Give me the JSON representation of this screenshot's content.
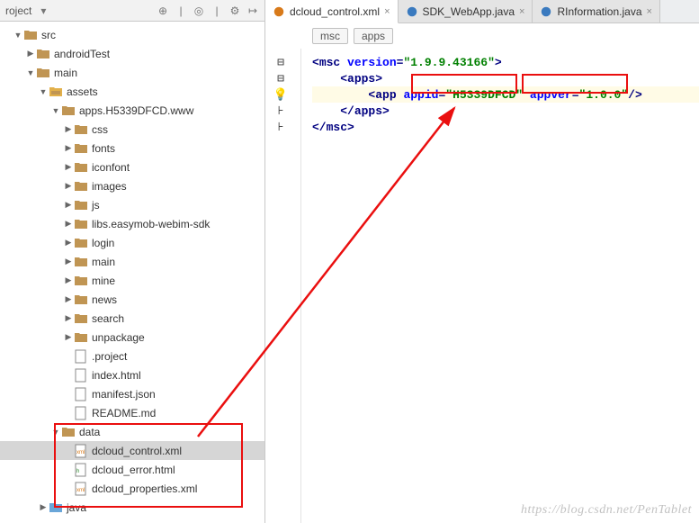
{
  "project_panel_title": "roject",
  "tree": {
    "src": "src",
    "androidTest": "androidTest",
    "main": "main",
    "assets": "assets",
    "apps_folder": "apps.H5339DFCD.www",
    "sub": {
      "css": "css",
      "fonts": "fonts",
      "iconfont": "iconfont",
      "images": "images",
      "js": "js",
      "libs": "libs.easymob-webim-sdk",
      "login": "login",
      "main": "main",
      "mine": "mine",
      "news": "news",
      "search": "search",
      "unpackage": "unpackage",
      "project_file": ".project",
      "index_html": "index.html",
      "manifest": "manifest.json",
      "readme": "README.md"
    },
    "data": "data",
    "data_children": {
      "control": "dcloud_control.xml",
      "error": "dcloud_error.html",
      "properties": "dcloud_properties.xml"
    },
    "java_folder": "java"
  },
  "tabs": [
    {
      "label": "dcloud_control.xml",
      "icon": "xml-file-icon",
      "active": true
    },
    {
      "label": "SDK_WebApp.java",
      "icon": "class-file-icon",
      "active": false
    },
    {
      "label": "RInformation.java",
      "icon": "class-file-icon",
      "active": false
    }
  ],
  "breadcrumbs": [
    "msc",
    "apps"
  ],
  "xml": {
    "root_tag": "msc",
    "version_attr": "version",
    "version_val": "\"1.9.9.43166\"",
    "apps_tag": "apps",
    "app_tag": "app",
    "appid_attr": "appid",
    "appid_val": "\"H5339DFCD\"",
    "appver_attr": "appver",
    "appver_val": "\"1.0.0\""
  },
  "watermark": "https://blog.csdn.net/PenTablet"
}
